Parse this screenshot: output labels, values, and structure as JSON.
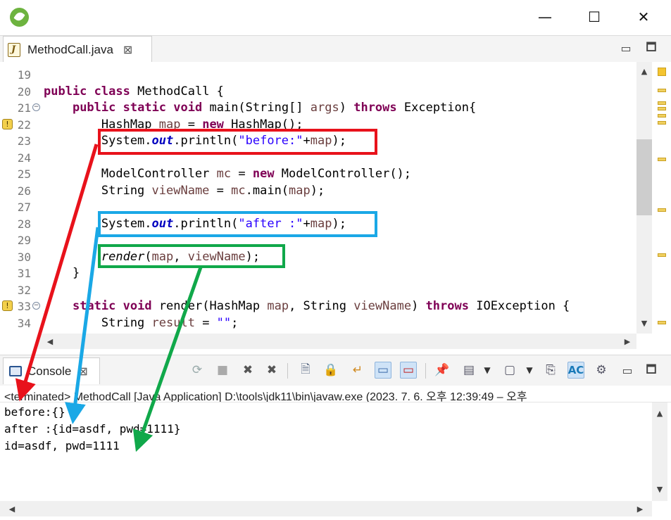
{
  "window": {
    "minimize": "—",
    "maximize": "☐",
    "close": "✕"
  },
  "editor": {
    "tab_label": "MethodCall.java",
    "tab_close": "⊠",
    "view_minimize": "▭",
    "view_maximize": "🗖",
    "lines": [
      {
        "num": "19",
        "code": ""
      },
      {
        "num": "20",
        "code": "public class MethodCall {"
      },
      {
        "num": "21",
        "code": "    public static void main(String[] args) throws Exception{"
      },
      {
        "num": "22",
        "code": "        HashMap map = new HashMap();"
      },
      {
        "num": "23",
        "code": "        System.out.println(\"before:\"+map);"
      },
      {
        "num": "24",
        "code": ""
      },
      {
        "num": "25",
        "code": "        ModelController mc = new ModelController();"
      },
      {
        "num": "26",
        "code": "        String viewName = mc.main(map);"
      },
      {
        "num": "27",
        "code": ""
      },
      {
        "num": "28",
        "code": "        System.out.println(\"after :\"+map);"
      },
      {
        "num": "29",
        "code": ""
      },
      {
        "num": "30",
        "code": "        render(map, viewName);"
      },
      {
        "num": "31",
        "code": "    }"
      },
      {
        "num": "32",
        "code": ""
      },
      {
        "num": "33",
        "code": "    static void render(HashMap map, String viewName) throws IOException {"
      },
      {
        "num": "34",
        "code": "        String result = \"\";"
      }
    ]
  },
  "console": {
    "tab_label": "Console",
    "tab_close": "⊠",
    "status": "<terminated> MethodCall [Java Application] D:\\tools\\jdk11\\bin\\javaw.exe  (2023. 7. 6. 오후 12:39:49 – 오후",
    "output": [
      "before:{}",
      "after :{id=asdf, pwd=1111}",
      "id=asdf, pwd=1111"
    ],
    "toolbar_icons": [
      "relaunch-icon",
      "terminate-icon",
      "remove-launch-icon",
      "remove-all-terminated-icon",
      "clear-console-icon",
      "scroll-lock-icon",
      "word-wrap-icon",
      "show-on-stdout-icon",
      "show-on-stderr-icon",
      "pin-console-icon",
      "display-console-icon",
      "open-console-icon",
      "copy-icon",
      "text-style-icon",
      "settings-icon"
    ]
  },
  "annotations": {
    "colors": {
      "before": "#e8121b",
      "after": "#1aa8e6",
      "render": "#10a84a"
    }
  }
}
